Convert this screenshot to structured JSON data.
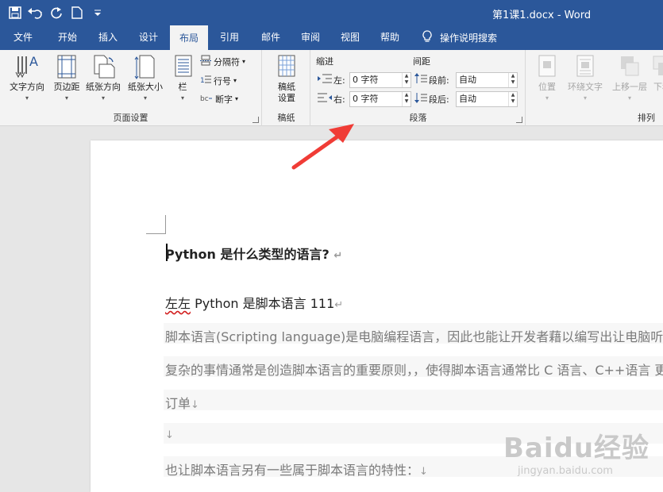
{
  "title_bar": {
    "document_title": "第1课1.docx  -  Word"
  },
  "tabs": [
    {
      "label": "文件"
    },
    {
      "label": "开始"
    },
    {
      "label": "插入"
    },
    {
      "label": "设计"
    },
    {
      "label": "布局"
    },
    {
      "label": "引用"
    },
    {
      "label": "邮件"
    },
    {
      "label": "审阅"
    },
    {
      "label": "视图"
    },
    {
      "label": "帮助"
    }
  ],
  "tell_me": "操作说明搜索",
  "ribbon": {
    "page_setup": {
      "label": "页面设置",
      "text_direction": "文字方向",
      "margins": "页边距",
      "orientation": "纸张方向",
      "size": "纸张大小",
      "columns": "栏",
      "breaks": "分隔符",
      "line_numbers": "行号",
      "hyphenation": "断字"
    },
    "manuscript": {
      "label": "稿纸",
      "setup_line1": "稿纸",
      "setup_line2": "设置"
    },
    "paragraph": {
      "label": "段落",
      "indent_heading": "缩进",
      "spacing_heading": "间距",
      "left_label": "左:",
      "right_label": "右:",
      "left_value": "0 字符",
      "right_value": "0 字符",
      "before_label": "段前:",
      "after_label": "段后:",
      "before_value": "自动",
      "after_value": "自动"
    },
    "arrange": {
      "label": "排列",
      "position": "位置",
      "wrap_text": "环绕文字",
      "bring_forward": "上移一层",
      "send_backward": "下移"
    }
  },
  "document": {
    "heading": "Python  是什么类型的语言?",
    "line1_prefix": "左左",
    "line1_rest": "  Python 是脚本语言 111",
    "para1": "脚本语言(Scripting language)是电脑编程语言，因此也能让开发者藉以编写出让电脑听命",
    "para2": "复杂的事情通常是创造脚本语言的重要原则，，使得脚本语言通常比 C 语言、C++语言 更",
    "para3": "订单",
    "para4": "",
    "para5": "也让脚本语言另有一些属于脚本语言的特性："
  },
  "watermark": {
    "main": "Baidu经验",
    "sub": "jingyan.baidu.com"
  },
  "colors": {
    "word_blue": "#2b579a",
    "arrow_red": "#f03c36"
  }
}
